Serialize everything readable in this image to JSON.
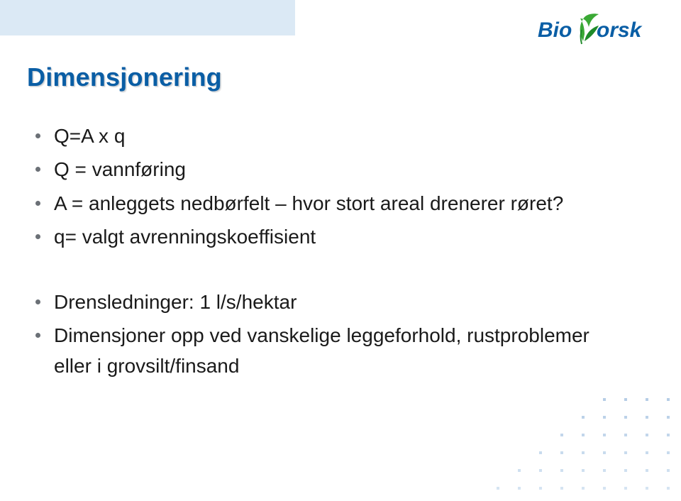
{
  "logo": {
    "name": "Bioforsk"
  },
  "title": "Dimensjonering",
  "bullets_group1": [
    "Q=A x q",
    "Q = vannføring",
    "A = anleggets nedbørfelt – hvor stort areal drenerer røret?",
    "q= valgt avrenningskoeffisient"
  ],
  "bullets_group2": [
    "Drensledninger: 1 l/s/hektar",
    "Dimensjoner opp ved vanskelige leggeforhold, rustproblemer eller i grovsilt/finsand"
  ]
}
